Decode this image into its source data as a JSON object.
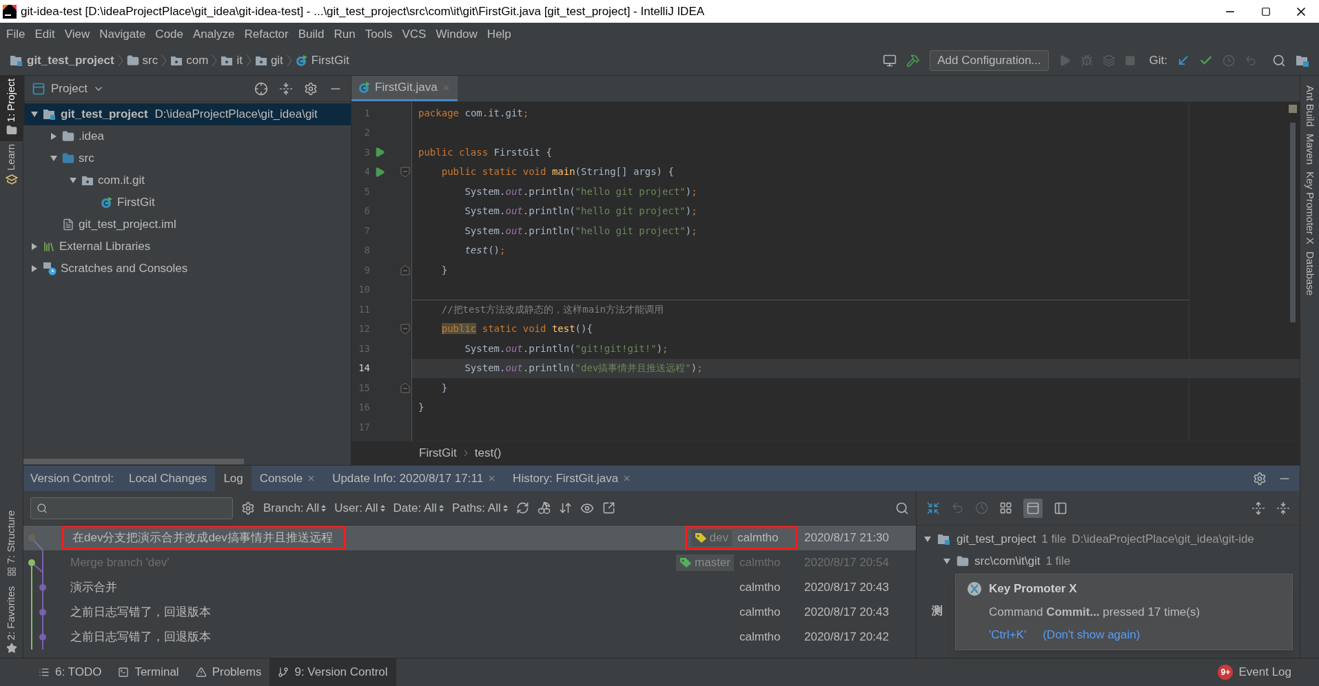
{
  "window": {
    "title": "git-idea-test [D:\\ideaProjectPlace\\git_idea\\git-idea-test] - ...\\git_test_project\\src\\com\\it\\git\\FirstGit.java [git_test_project] - IntelliJ IDEA"
  },
  "menu": [
    "File",
    "Edit",
    "View",
    "Navigate",
    "Code",
    "Analyze",
    "Refactor",
    "Build",
    "Run",
    "Tools",
    "VCS",
    "Window",
    "Help"
  ],
  "breadcrumb": [
    {
      "label": "git_test_project",
      "kind": "project"
    },
    {
      "label": "src",
      "kind": "folder"
    },
    {
      "label": "com",
      "kind": "package"
    },
    {
      "label": "it",
      "kind": "package"
    },
    {
      "label": "git",
      "kind": "package"
    },
    {
      "label": "FirstGit",
      "kind": "class"
    }
  ],
  "toolbar": {
    "configuration": "Add Configuration...",
    "git_label": "Git:"
  },
  "left_stripe": [
    {
      "label": "1: Project",
      "selected": true
    },
    {
      "label": "Learn",
      "selected": false
    }
  ],
  "left_stripe_bottom": [
    {
      "label": "7: Structure",
      "selected": false
    },
    {
      "label": "2: Favorites",
      "selected": false
    }
  ],
  "right_stripe": [
    "Ant Build",
    "Maven",
    "Key Promoter X",
    "Database"
  ],
  "project_panel": {
    "title": "Project",
    "tree": [
      {
        "label": "git_test_project",
        "detail": "D:\\ideaProjectPlace\\git_idea\\git",
        "kind": "project",
        "expanded": true,
        "selected": true,
        "children": [
          {
            "label": ".idea",
            "kind": "folder",
            "expanded": false,
            "selected": false
          },
          {
            "label": "src",
            "kind": "source",
            "expanded": true,
            "selected": false,
            "children": [
              {
                "label": "com.it.git",
                "kind": "package",
                "expanded": true,
                "selected": false,
                "children": [
                  {
                    "label": "FirstGit",
                    "kind": "class",
                    "selected": false
                  }
                ]
              }
            ]
          },
          {
            "label": "git_test_project.iml",
            "kind": "file",
            "selected": false
          }
        ]
      },
      {
        "label": "External Libraries",
        "kind": "libraries",
        "expanded": false,
        "selected": false
      },
      {
        "label": "Scratches and Consoles",
        "kind": "scratches",
        "expanded": false,
        "selected": false
      }
    ]
  },
  "editor": {
    "tabs": [
      {
        "label": "FirstGit.java",
        "selected": true
      }
    ],
    "lines": [
      {
        "number": "1",
        "current": false,
        "run": false,
        "fold_start": false,
        "fold_end": false,
        "tokens": [
          {
            "kind": "kw",
            "text": "package"
          },
          {
            "kind": "plain",
            "text": " com.it.git"
          },
          {
            "kind": "kw",
            "text": ";"
          }
        ]
      },
      {
        "number": "2",
        "current": false,
        "run": false,
        "fold_start": false,
        "fold_end": false
      },
      {
        "number": "3",
        "current": false,
        "run": true,
        "fold_start": false,
        "fold_end": false,
        "tokens": [
          {
            "kind": "kw",
            "text": "public class "
          },
          {
            "kind": "plain",
            "text": "FirstGit {"
          }
        ]
      },
      {
        "number": "4",
        "current": false,
        "run": true,
        "fold_start": true,
        "fold_end": false,
        "tokens": [
          {
            "kind": "kw",
            "text": "    public static void "
          },
          {
            "kind": "fn",
            "text": "main"
          },
          {
            "kind": "plain",
            "text": "(String[] args) {"
          }
        ]
      },
      {
        "number": "5",
        "current": false,
        "run": false,
        "fold_start": false,
        "fold_end": false,
        "tokens": [
          {
            "kind": "plain",
            "text": "        System."
          },
          {
            "kind": "field",
            "text": "out"
          },
          {
            "kind": "plain",
            "text": ".println("
          },
          {
            "kind": "str",
            "text": "\"hello git project\""
          },
          {
            "kind": "plain",
            "text": ")"
          },
          {
            "kind": "kw",
            "text": ";"
          }
        ]
      },
      {
        "number": "6",
        "current": false,
        "run": false,
        "fold_start": false,
        "fold_end": false,
        "tokens": [
          {
            "kind": "plain",
            "text": "        System."
          },
          {
            "kind": "field",
            "text": "out"
          },
          {
            "kind": "plain",
            "text": ".println("
          },
          {
            "kind": "str",
            "text": "\"hello git project\""
          },
          {
            "kind": "plain",
            "text": ")"
          },
          {
            "kind": "kw",
            "text": ";"
          }
        ]
      },
      {
        "number": "7",
        "current": false,
        "run": false,
        "fold_start": false,
        "fold_end": false,
        "tokens": [
          {
            "kind": "plain",
            "text": "        System."
          },
          {
            "kind": "field",
            "text": "out"
          },
          {
            "kind": "plain",
            "text": ".println("
          },
          {
            "kind": "str",
            "text": "\"hello git project\""
          },
          {
            "kind": "plain",
            "text": ")"
          },
          {
            "kind": "kw",
            "text": ";"
          }
        ]
      },
      {
        "number": "8",
        "current": false,
        "run": false,
        "fold_start": false,
        "fold_end": false,
        "tokens": [
          {
            "kind": "call",
            "text": "        test"
          },
          {
            "kind": "plain",
            "text": "()"
          },
          {
            "kind": "kw",
            "text": ";"
          }
        ]
      },
      {
        "number": "9",
        "current": false,
        "run": false,
        "fold_start": false,
        "fold_end": true,
        "tokens": [
          {
            "kind": "plain",
            "text": "    }"
          }
        ]
      },
      {
        "number": "10",
        "current": false,
        "run": false,
        "fold_start": false,
        "fold_end": false
      },
      {
        "number": "11",
        "current": false,
        "run": false,
        "fold_start": false,
        "fold_end": false,
        "tokens": [
          {
            "kind": "comment",
            "text": "    //把test方法改成静态的，这样main方法才能调用"
          }
        ]
      },
      {
        "number": "12",
        "current": false,
        "run": false,
        "fold_start": true,
        "fold_end": false,
        "tokens": [
          {
            "kind": "kw-highlight",
            "text": "    public"
          },
          {
            "kind": "kw",
            "text": " static void "
          },
          {
            "kind": "fn",
            "text": "test"
          },
          {
            "kind": "plain",
            "text": "(){"
          }
        ]
      },
      {
        "number": "13",
        "current": false,
        "run": false,
        "fold_start": false,
        "fold_end": false,
        "tokens": [
          {
            "kind": "plain",
            "text": "        System."
          },
          {
            "kind": "field",
            "text": "out"
          },
          {
            "kind": "plain",
            "text": ".println("
          },
          {
            "kind": "str",
            "text": "\"git!git!git!\""
          },
          {
            "kind": "plain",
            "text": ")"
          },
          {
            "kind": "kw",
            "text": ";"
          }
        ]
      },
      {
        "number": "14",
        "current": true,
        "run": false,
        "fold_start": false,
        "fold_end": false,
        "tokens": [
          {
            "kind": "plain",
            "text": "        System."
          },
          {
            "kind": "field",
            "text": "out"
          },
          {
            "kind": "plain",
            "text": ".println("
          },
          {
            "kind": "str",
            "text": "\"dev搞事情并且推送远程\""
          },
          {
            "kind": "plain",
            "text": ")"
          },
          {
            "kind": "kw",
            "text": ";"
          }
        ]
      },
      {
        "number": "15",
        "current": false,
        "run": false,
        "fold_start": false,
        "fold_end": true,
        "tokens": [
          {
            "kind": "plain",
            "text": "    }"
          }
        ]
      },
      {
        "number": "16",
        "current": false,
        "run": false,
        "fold_start": false,
        "fold_end": false,
        "tokens": [
          {
            "kind": "plain",
            "text": "}"
          }
        ]
      },
      {
        "number": "17",
        "current": false,
        "run": false,
        "fold_start": false,
        "fold_end": false
      }
    ],
    "path": [
      "FirstGit",
      "test()"
    ]
  },
  "version_control": {
    "label": "Version Control:",
    "tabs": [
      {
        "label": "Local Changes",
        "selected": false,
        "closable": false
      },
      {
        "label": "Log",
        "selected": true,
        "closable": false
      },
      {
        "label": "Console",
        "selected": false,
        "closable": true
      },
      {
        "label": "Update Info: 2020/8/17 17:11",
        "selected": false,
        "closable": true
      },
      {
        "label": "History: FirstGit.java",
        "selected": false,
        "closable": true
      }
    ],
    "filters": [
      "Branch: All",
      "User: All",
      "Date: All",
      "Paths: All"
    ],
    "commits": [
      {
        "message": "在dev分支把演示合并改成dev搞事情并且推送远程",
        "refs": [
          {
            "name": "dev",
            "color": "#d9c22b"
          }
        ],
        "author": "calmtho",
        "date": "2020/8/17 21:30",
        "selected": true,
        "dimmed": false,
        "annotated": true,
        "color": "#6e6455"
      },
      {
        "message": "Merge branch 'dev'",
        "refs": [
          {
            "name": "master",
            "color": "#4fb35a"
          }
        ],
        "author": "calmtho",
        "date": "2020/8/17 20:54",
        "selected": false,
        "dimmed": true,
        "annotated": false,
        "color": "#8fb86a"
      },
      {
        "message": "演示合并",
        "author": "calmtho",
        "date": "2020/8/17 20:43",
        "selected": false,
        "dimmed": false,
        "annotated": false,
        "color": "#7a5fb0"
      },
      {
        "message": "之前日志写错了，回退版本",
        "author": "calmtho",
        "date": "2020/8/17 20:43",
        "selected": false,
        "dimmed": false,
        "annotated": false,
        "color": "#7a5fb0"
      },
      {
        "message": "之前日志写错了，回退版本",
        "author": "calmtho",
        "date": "2020/8/17 20:42",
        "selected": false,
        "dimmed": false,
        "annotated": false,
        "color": "#7a5fb0"
      }
    ],
    "changes": [
      {
        "label": "git_test_project",
        "count": "1 file",
        "detail": "D:\\ideaProjectPlace\\git_idea\\git-ide",
        "kind": "project",
        "expanded": true
      },
      {
        "label": "src\\com\\it\\git",
        "count": "1 file",
        "kind": "folder",
        "expanded": true
      }
    ],
    "details_text": "测"
  },
  "notification": {
    "title": "Key Promoter X",
    "message": "Command **Commit...** pressed 17 time(s)",
    "links": [
      "'Ctrl+K'",
      "(Don't show again)"
    ]
  },
  "bottom_tabs": [
    {
      "label": "6: TODO",
      "kind": "todo",
      "selected": false
    },
    {
      "label": "Terminal",
      "kind": "terminal",
      "selected": false
    },
    {
      "label": "Problems",
      "kind": "problems",
      "selected": false
    },
    {
      "label": "9: Version Control",
      "kind": "vcs",
      "selected": true
    }
  ],
  "event_log": {
    "label": "Event Log",
    "badge": "9+"
  }
}
